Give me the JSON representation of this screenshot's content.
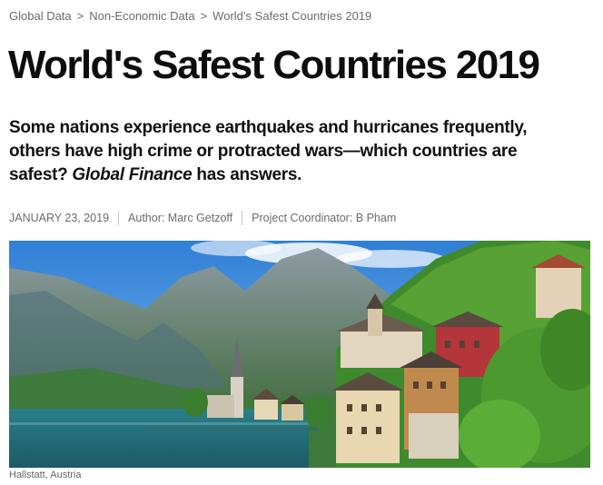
{
  "breadcrumb": {
    "items": [
      {
        "label": "Global Data"
      },
      {
        "label": "Non-Economic Data"
      },
      {
        "label": "World’s Safest Countries 2019"
      }
    ],
    "separator": ">"
  },
  "article": {
    "title": "World's Safest Countries 2019",
    "dek_part1": "Some nations experience earthquakes and hurricanes frequently, others have high crime or protracted wars—which countries are safest? ",
    "dek_italic": "Global Finance",
    "dek_part2": " has answers.",
    "date": "JANUARY 23, 2019",
    "author": "Author: Marc Getzoff",
    "coordinator": "Project Coordinator: B Pham"
  },
  "image": {
    "caption": "Hallstatt, Austria"
  },
  "colors": {
    "text": "#111111",
    "muted": "#6b6b6b",
    "divider": "#c9c9c9"
  }
}
